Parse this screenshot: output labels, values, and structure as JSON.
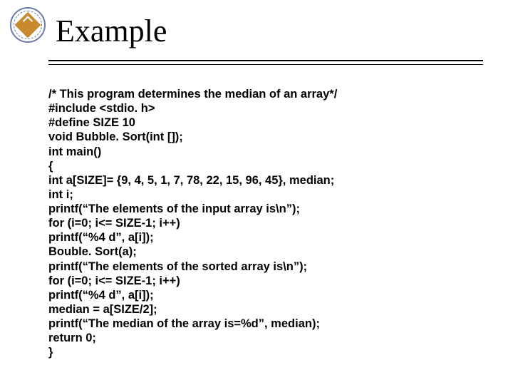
{
  "title": "Example",
  "code_lines": [
    "/* This program determines the median of an array*/",
    "#include <stdio. h>",
    "#define SIZE 10",
    "void Bubble. Sort(int []);",
    "int main()",
    "{",
    "int a[SIZE]= {9, 4, 5, 1, 7, 78, 22, 15, 96, 45}, median;",
    "int i;",
    "printf(“The elements of the input array is\\n”);",
    "for (i=0; i<= SIZE-1; i++)",
    "printf(“%4 d”, a[i]);",
    "Bouble. Sort(a);",
    "printf(“The elements of the sorted array is\\n”);",
    "for (i=0; i<= SIZE-1; i++)",
    "printf(“%4 d”, a[i]);",
    "median = a[SIZE/2];",
    "printf(“The median of the array is=%d”, median);",
    "return 0;",
    "}"
  ]
}
